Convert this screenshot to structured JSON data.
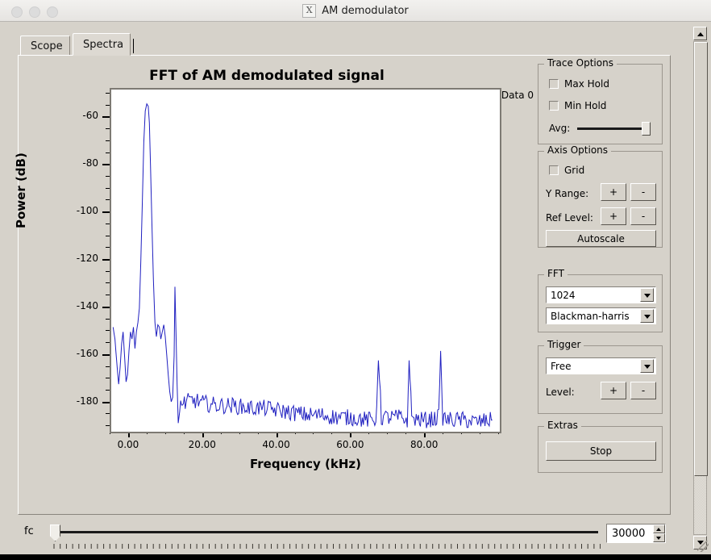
{
  "window": {
    "title": "AM demodulator",
    "icon": "x11-icon",
    "traffic_lights": [
      "close",
      "minimize",
      "zoom"
    ]
  },
  "tabs": [
    {
      "label": "Scope",
      "active": false
    },
    {
      "label": "Spectra",
      "active": true
    }
  ],
  "plot": {
    "legend_label": "Data 0",
    "trace_color": "#2020c0"
  },
  "panels": {
    "trace_options": {
      "title": "Trace Options",
      "max_hold": "Max Hold",
      "min_hold": "Min Hold",
      "avg_label": "Avg:"
    },
    "axis_options": {
      "title": "Axis Options",
      "grid": "Grid",
      "y_range_label": "Y Range:",
      "ref_level_label": "Ref Level:",
      "plus": "+",
      "minus": "-",
      "autoscale": "Autoscale"
    },
    "fft": {
      "title": "FFT",
      "size": "1024",
      "window": "Blackman-harris"
    },
    "trigger": {
      "title": "Trigger",
      "mode": "Free",
      "level_label": "Level:",
      "plus": "+",
      "minus": "-"
    },
    "extras": {
      "title": "Extras",
      "stop": "Stop"
    }
  },
  "fc_control": {
    "label": "fc",
    "value": "30000"
  },
  "chart_data": {
    "type": "line",
    "title": "FFT of AM demodulated signal",
    "xlabel": "Frequency (kHz)",
    "ylabel": "Power (dB)",
    "xlim": [
      -5,
      100
    ],
    "ylim": [
      -192,
      -48
    ],
    "grid": false,
    "legend_position": "top-right",
    "xticks": [
      0,
      20,
      40,
      60,
      80
    ],
    "xtick_labels": [
      "0.00",
      "20.00",
      "40.00",
      "60.00",
      "80.00"
    ],
    "xminor_step": 5,
    "yticks": [
      -60,
      -80,
      -100,
      -120,
      -140,
      -160,
      -180
    ],
    "ytick_labels": [
      "-60",
      "-80",
      "-100",
      "-120",
      "-140",
      "-160",
      "-180"
    ],
    "yminor_step": 5,
    "series": [
      {
        "name": "Data 0",
        "color": "#2020c0",
        "peaks": [
          {
            "x": 5.0,
            "y": -54
          },
          {
            "x": 12.2,
            "y": -131
          },
          {
            "x": 67.2,
            "y": -162
          },
          {
            "x": 75.5,
            "y": -162
          },
          {
            "x": 84.0,
            "y": -158
          }
        ],
        "noise_floor_start": -182,
        "noise_floor_end": -190,
        "x": [
          -4.5,
          -4.0,
          -3.5,
          -3.0,
          -2.6,
          -2.2,
          -1.8,
          -1.4,
          -1.0,
          -0.6,
          -0.2,
          0.2,
          0.6,
          1.0,
          1.4,
          1.8,
          2.2,
          2.6,
          3.0,
          3.4,
          3.8,
          4.2,
          4.6,
          5.0,
          5.3,
          5.6,
          6.0,
          6.4,
          6.8,
          7.2,
          7.6,
          8.0,
          8.4,
          8.8,
          9.2,
          9.6,
          10.0,
          10.4,
          10.8,
          11.2,
          11.6,
          12.0,
          12.2,
          12.5,
          12.8,
          13.1,
          13.5,
          14.0,
          15.0,
          16.0,
          18.0,
          20.0,
          24.0,
          28.0,
          32.0,
          36.0,
          40.0,
          44.0,
          48.0,
          52.0,
          56.0,
          60.0,
          64.0,
          66.5,
          67.2,
          68.0,
          70.0,
          73.0,
          75.0,
          75.5,
          76.2,
          78.0,
          81.0,
          83.5,
          84.0,
          84.6,
          86.0,
          90.0,
          94.0,
          98.0
        ],
        "y": [
          -148,
          -153,
          -163,
          -172,
          -165,
          -155,
          -150,
          -160,
          -171,
          -168,
          -158,
          -150,
          -153,
          -148,
          -157,
          -150,
          -146,
          -140,
          -120,
          -95,
          -70,
          -57,
          -54,
          -55,
          -62,
          -80,
          -105,
          -128,
          -146,
          -152,
          -147,
          -148,
          -153,
          -150,
          -147,
          -152,
          -160,
          -168,
          -175,
          -180,
          -178,
          -160,
          -131,
          -150,
          -172,
          -188,
          -182,
          -179,
          -180,
          -179,
          -179,
          -180,
          -181,
          -181,
          -182,
          -182,
          -183,
          -184,
          -185,
          -185,
          -186,
          -186,
          -187,
          -187,
          -162,
          -186,
          -186,
          -186,
          -187,
          -162,
          -186,
          -187,
          -187,
          -186,
          -158,
          -186,
          -187,
          -187,
          -188,
          -187
        ]
      }
    ]
  }
}
